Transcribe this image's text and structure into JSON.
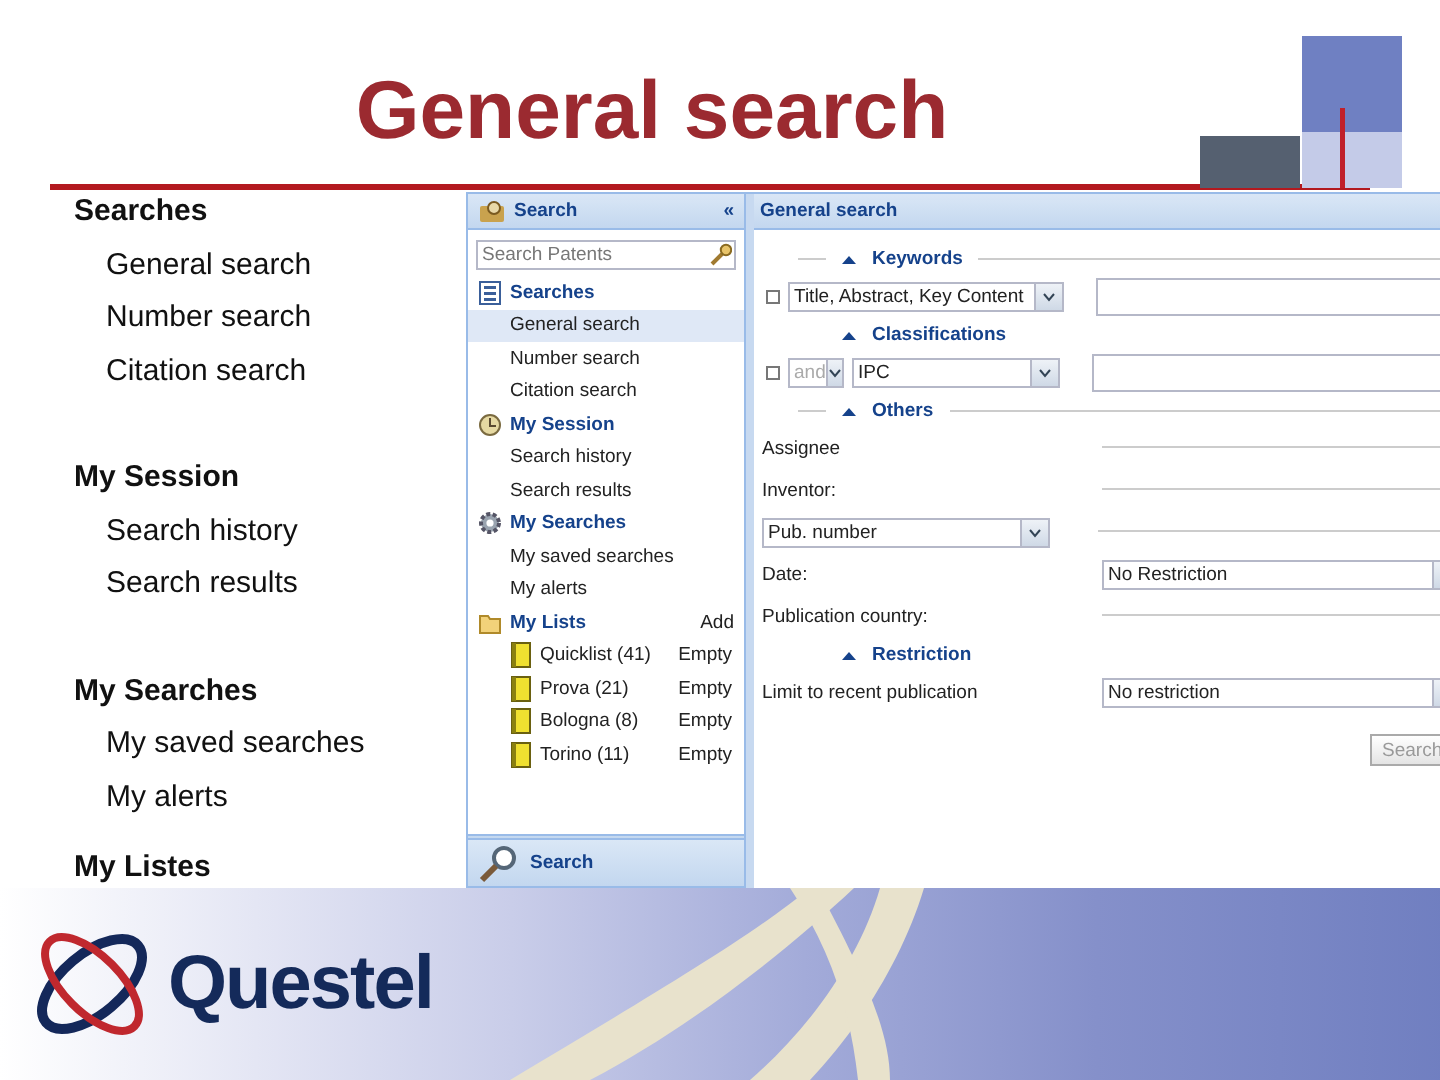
{
  "slide": {
    "title": "General search"
  },
  "outline": [
    {
      "label": "Searches",
      "children": [
        {
          "label": "General search"
        },
        {
          "label": "Number search"
        },
        {
          "label": "Citation search"
        }
      ]
    },
    {
      "label": "My Session",
      "children": [
        {
          "label": "Search history"
        },
        {
          "label": "Search results"
        }
      ]
    },
    {
      "label": "My Searches",
      "children": [
        {
          "label": "My saved searches"
        },
        {
          "label": "My alerts"
        }
      ]
    },
    {
      "label": "My Listes"
    }
  ],
  "sidebar": {
    "title": "Search",
    "collapse": "«",
    "search_placeholder": "Search Patents",
    "footer": "Search",
    "sections": [
      {
        "label": "Searches",
        "items": [
          {
            "label": "General search",
            "selected": true
          },
          {
            "label": "Number search",
            "selected": false
          },
          {
            "label": "Citation search",
            "selected": false
          }
        ]
      },
      {
        "label": "My Session",
        "items": [
          {
            "label": "Search history",
            "selected": false
          },
          {
            "label": "Search results",
            "selected": false
          }
        ]
      },
      {
        "label": "My Searches",
        "items": [
          {
            "label": "My saved searches",
            "selected": false
          },
          {
            "label": "My alerts",
            "selected": false
          }
        ]
      },
      {
        "label": "My Lists",
        "action": "Add",
        "items": [
          {
            "label": "Quicklist (41)",
            "status": "Empty",
            "selected": false
          },
          {
            "label": "Prova (21)",
            "status": "Empty",
            "selected": false
          },
          {
            "label": "Bologna (8)",
            "status": "Empty",
            "selected": false
          },
          {
            "label": "Torino (11)",
            "status": "Empty",
            "selected": false
          }
        ]
      }
    ]
  },
  "form": {
    "title": "General search",
    "button": "Search",
    "groups": [
      {
        "legend": "Keywords",
        "rule": true,
        "rows": [
          {
            "kind": "criteria",
            "selects": [
              {
                "value": "Title, Abstract, Key Content",
                "disabled": false
              }
            ]
          }
        ]
      },
      {
        "legend": "Classifications",
        "rule": false,
        "rows": [
          {
            "kind": "criteria",
            "selects": [
              {
                "value": "and",
                "disabled": true
              },
              {
                "value": "IPC",
                "disabled": false
              }
            ]
          }
        ]
      },
      {
        "legend": "Others",
        "rule": true,
        "rows": [
          {
            "kind": "text",
            "label": "Assignee"
          },
          {
            "kind": "text",
            "label": "Inventor:"
          },
          {
            "kind": "select-text",
            "value": "Pub. number"
          },
          {
            "kind": "select",
            "label": "Date:",
            "value": "No Restriction"
          },
          {
            "kind": "text",
            "label": "Publication country:"
          }
        ]
      },
      {
        "legend": "Restriction",
        "rule": false,
        "rows": [
          {
            "kind": "select",
            "label": "Limit to recent publication",
            "value": "No restriction"
          }
        ]
      }
    ]
  },
  "footer": {
    "logo": "Questel"
  }
}
